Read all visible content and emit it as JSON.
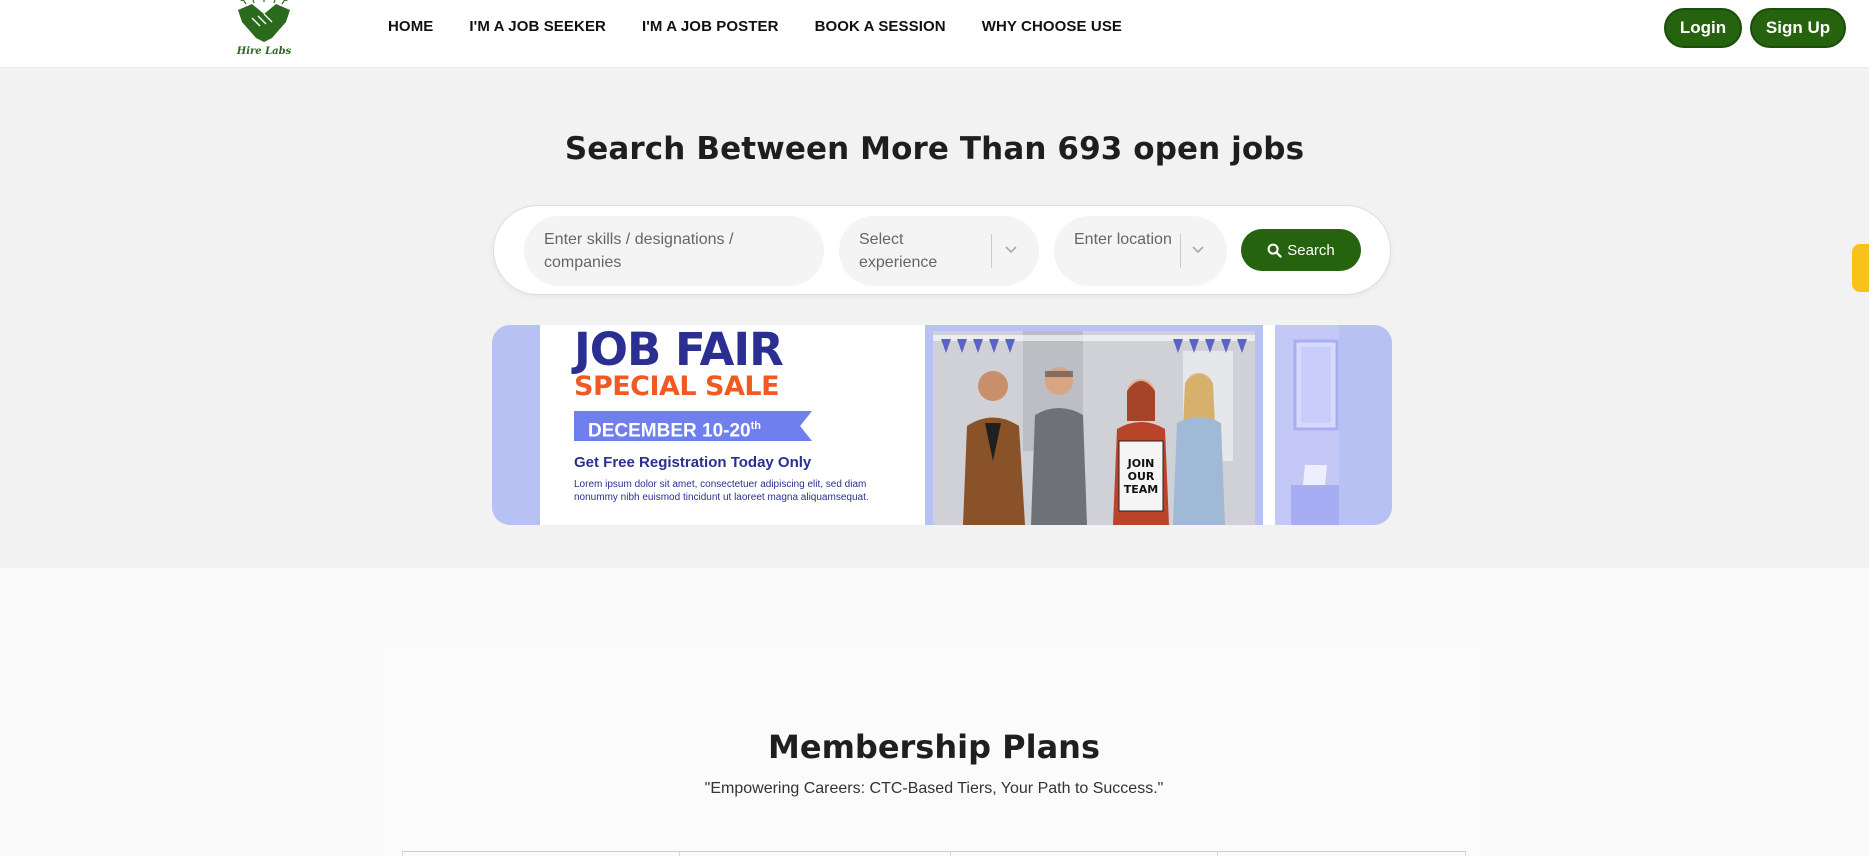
{
  "brand": {
    "logo_text": "Hire Labs"
  },
  "nav": {
    "items": [
      {
        "label": "HOME"
      },
      {
        "label": "I'M A JOB SEEKER"
      },
      {
        "label": "I'M A JOB POSTER"
      },
      {
        "label": "BOOK A SESSION"
      },
      {
        "label": "WHY CHOOSE USE"
      }
    ],
    "login_label": "Login",
    "signup_label": "Sign Up"
  },
  "hero": {
    "title": "Search Between More Than 693 open jobs",
    "skills_placeholder": "Enter skills / designations / companies",
    "experience_placeholder": "Select experience",
    "location_placeholder": "Enter location",
    "search_label": "Search"
  },
  "banner": {
    "title": "JOB FAIR",
    "subtitle": "SPECIAL SALE",
    "date": "DECEMBER 10-20",
    "date_suffix": "th",
    "cta": "Get Free Registration Today Only",
    "body": "Lorem ipsum dolor sit amet, consectetuer adipiscing elit, sed diam nonummy nibh euismod tincidunt ut laoreet magna aliquamsequat.",
    "sign_text": "JOIN OUR TEAM"
  },
  "membership": {
    "title": "Membership Plans",
    "subtitle": "\"Empowering Careers: CTC-Based Tiers, Your Path to Success.\""
  },
  "colors": {
    "brand_green": "#25630f",
    "banner_blue": "#2b2f91",
    "banner_orange": "#f05a22",
    "side_tab": "#f7c21a"
  }
}
